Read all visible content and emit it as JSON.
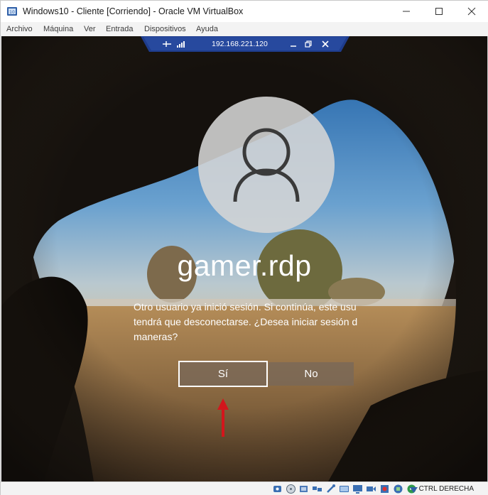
{
  "window": {
    "title": "Windows10 - Cliente [Corriendo] - Oracle VM VirtualBox",
    "icon": "virtualbox-icon",
    "controls": [
      "minimize-icon",
      "maximize-icon",
      "close-icon"
    ]
  },
  "menu": {
    "items": [
      "Archivo",
      "Máquina",
      "Ver",
      "Entrada",
      "Dispositivos",
      "Ayuda"
    ]
  },
  "rdp_bar": {
    "ip": "192.168.221.120",
    "icons": [
      "pin-icon",
      "signal-icon",
      "minimize-icon",
      "restore-icon",
      "close-icon"
    ],
    "accent_color": "#1e3c8c"
  },
  "login": {
    "username": "gamer.rdp",
    "message_lines": [
      "Otro usuario ya inició sesión. Si continúa, este usu",
      "tendrá que desconectarse. ¿Desea iniciar sesión d",
      "maneras?"
    ],
    "yes_label": "Sí",
    "no_label": "No"
  },
  "annotation": {
    "arrow_color": "#d3161c"
  },
  "status_bar": {
    "icons": [
      "hard-disk-icon",
      "optical-disk-icon",
      "audio-icon",
      "network-icon",
      "usb-icon",
      "shared-folders-icon",
      "display-icon",
      "video-capture-icon",
      "recording-icon",
      "cpu-icon",
      "mouse-integration-icon",
      "keyboard-icon"
    ],
    "host_key": "CTRL DERECHA"
  }
}
